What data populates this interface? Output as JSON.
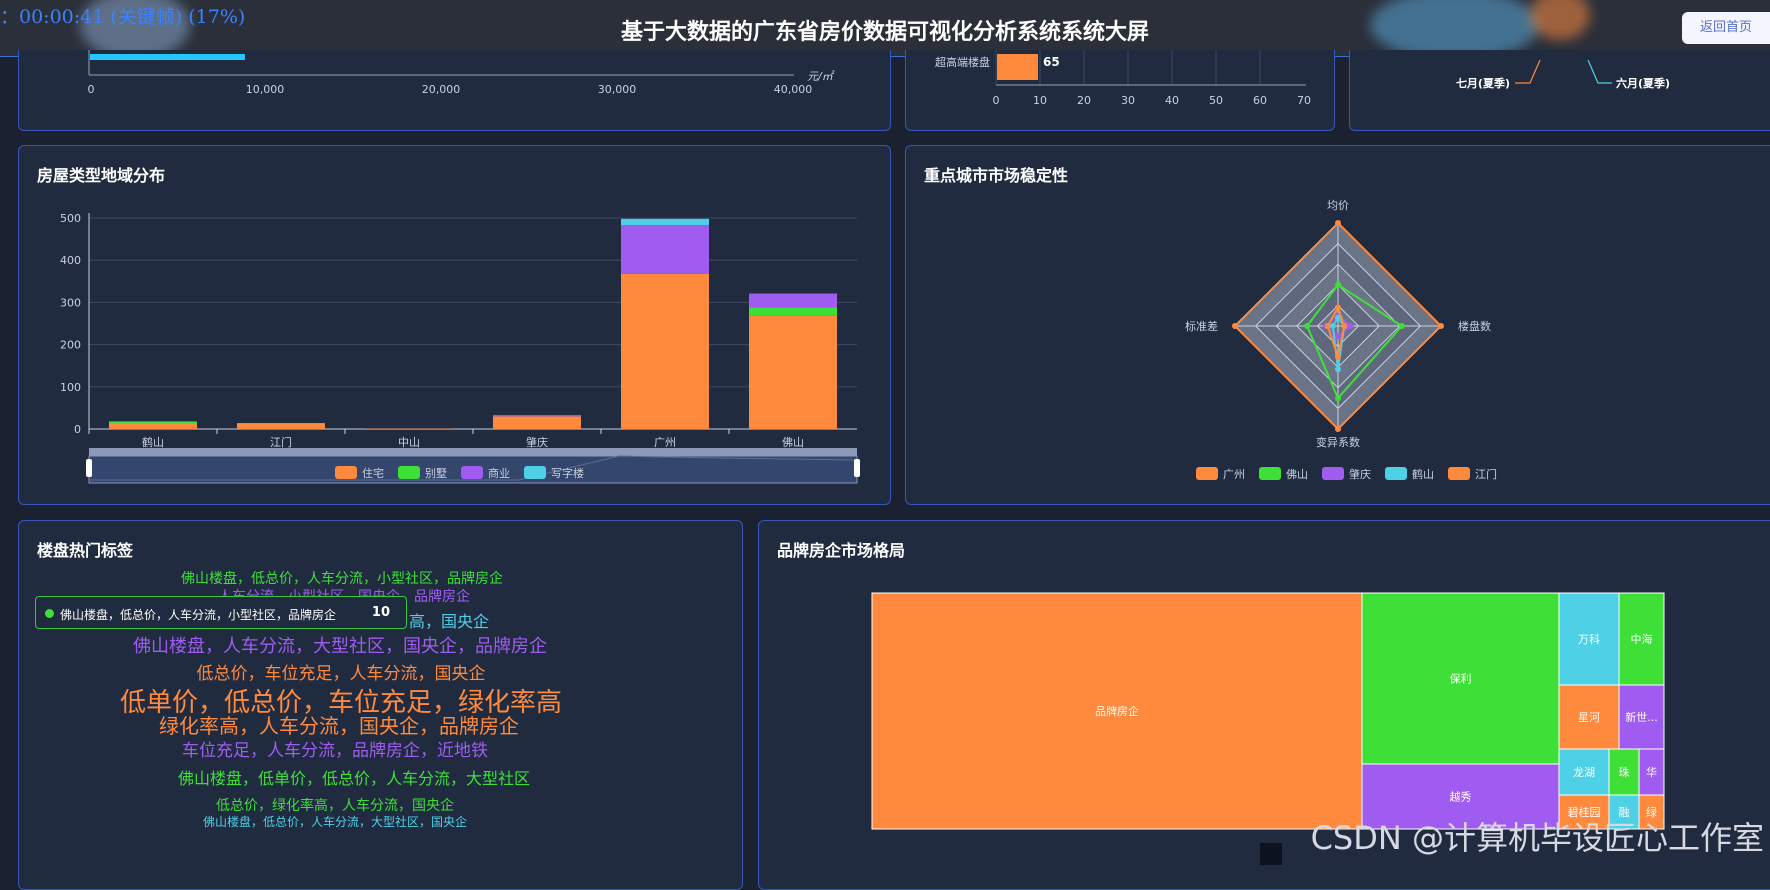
{
  "header": {
    "timer": "：00:00:41 (关键帧) (17%)",
    "title": "基于大数据的广东省房价数据可视化分析系统系统大屏",
    "back_button": "返回首页"
  },
  "price_axis_panel": {
    "ticks": [
      "0",
      "10,000",
      "20,000",
      "30,000",
      "40,000"
    ],
    "unit": "元/㎡",
    "bar_value_fraction": 0.22
  },
  "top_middle_panel": {
    "category": "超高端楼盘",
    "value": "65",
    "ticks": [
      "0",
      "10",
      "20",
      "30",
      "40",
      "50",
      "60",
      "70"
    ]
  },
  "top_right_panel": {
    "labels": [
      "七月(夏季)",
      "六月(夏季)"
    ]
  },
  "house_type_panel": {
    "title": "房屋类型地域分布",
    "chart_data": {
      "type": "bar",
      "stacked": true,
      "categories": [
        "鹤山",
        "江门",
        "中山",
        "肇庆",
        "广州",
        "佛山"
      ],
      "series": [
        {
          "name": "住宅",
          "color": "#ff8a3d",
          "values": [
            13,
            14,
            1,
            30,
            368,
            268
          ]
        },
        {
          "name": "别墅",
          "color": "#3ee038",
          "values": [
            5,
            0,
            0,
            0,
            0,
            20
          ]
        },
        {
          "name": "商业",
          "color": "#a05cf0",
          "values": [
            0,
            0,
            0,
            3,
            115,
            33
          ]
        },
        {
          "name": "写字楼",
          "color": "#4ed0e6",
          "values": [
            0,
            0,
            0,
            0,
            15,
            0
          ]
        }
      ],
      "yticks": [
        "0",
        "100",
        "200",
        "300",
        "400",
        "500"
      ],
      "ylim": [
        0,
        500
      ],
      "grid": true,
      "legend": "bottom"
    }
  },
  "stability_panel": {
    "title": "重点城市市场稳定性",
    "chart_data": {
      "type": "radar",
      "indicators": [
        "均价",
        "楼盘数",
        "变异系数",
        "标准差"
      ],
      "series": [
        {
          "name": "广州",
          "color": "#ff8a3d",
          "values": [
            1.0,
            1.0,
            1.0,
            1.0
          ]
        },
        {
          "name": "佛山",
          "color": "#3ee038",
          "values": [
            0.4,
            0.62,
            0.7,
            0.3
          ]
        },
        {
          "name": "肇庆",
          "color": "#a05cf0",
          "values": [
            0.1,
            0.12,
            0.1,
            0.12
          ]
        },
        {
          "name": "鹤山",
          "color": "#4ed0e6",
          "values": [
            0.08,
            0.06,
            0.42,
            0.05
          ]
        },
        {
          "name": "江门",
          "color": "#ff8a3d",
          "values": [
            0.18,
            0.06,
            0.3,
            0.1
          ]
        }
      ],
      "legend": "bottom"
    }
  },
  "tags_panel": {
    "title": "楼盘热门标签",
    "lines": [
      {
        "text": "佛山楼盘，低总价，人车分流，小型社区，品牌房企",
        "color": "#3ee038",
        "size": 14
      },
      {
        "text": "人车分流，小型社区，国央企，品牌房企",
        "color": "#a05cf0",
        "size": 14
      },
      {
        "text": "高，国央企",
        "color": "#4ed0e6",
        "size": 16
      },
      {
        "text": "佛山楼盘，人车分流，大型社区，国央企，品牌房企",
        "color": "#a05cf0",
        "size": 18
      },
      {
        "text": "低总价，车位充足，人车分流，国央企",
        "color": "#ff8a3d",
        "size": 17
      },
      {
        "text": "低单价，低总价，车位充足，绿化率高",
        "color": "#ff8a3d",
        "size": 26
      },
      {
        "text": "绿化率高，人车分流，国央企，品牌房企",
        "color": "#ff8a3d",
        "size": 20
      },
      {
        "text": "车位充足，人车分流，品牌房企，近地铁",
        "color": "#a05cf0",
        "size": 17
      },
      {
        "text": "佛山楼盘，低单价，低总价，人车分流，大型社区",
        "color": "#3ee038",
        "size": 16
      },
      {
        "text": "低总价，绿化率高，人车分流，国央企",
        "color": "#3ee038",
        "size": 14
      },
      {
        "text": "佛山楼盘，低总价，人车分流，大型社区，国央企",
        "color": "#4ed0e6",
        "size": 12
      }
    ],
    "tooltip": {
      "text": "佛山楼盘，低总价，人车分流，小型社区，品牌房企",
      "value": "10"
    }
  },
  "brand_panel": {
    "title": "品牌房企市场格局",
    "chart_data": {
      "type": "treemap",
      "items": [
        {
          "name": "品牌房企",
          "color": "#ff8a3d"
        },
        {
          "name": "保利",
          "color": "#3ee038"
        },
        {
          "name": "越秀",
          "color": "#a05cf0"
        },
        {
          "name": "万科",
          "color": "#4ed0e6"
        },
        {
          "name": "中海",
          "color": "#3ee038"
        },
        {
          "name": "星河",
          "color": "#ff8a3d"
        },
        {
          "name": "新世...",
          "color": "#a05cf0"
        },
        {
          "name": "龙湖",
          "color": "#4ed0e6"
        },
        {
          "name": "珠",
          "color": "#3ee038"
        },
        {
          "name": "华",
          "color": "#a05cf0"
        },
        {
          "name": "碧桂园",
          "color": "#ff8a3d"
        },
        {
          "name": "融",
          "color": "#4ed0e6"
        },
        {
          "name": "绿",
          "color": "#ff8a3d"
        }
      ]
    }
  },
  "watermark": "CSDN @计算机毕设匠心工作室"
}
